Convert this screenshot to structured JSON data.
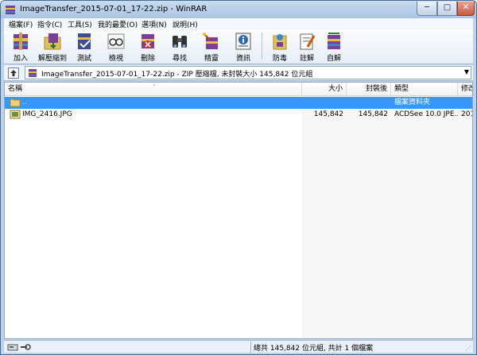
{
  "window": {
    "title": "ImageTransfer_2015-07-01_17-22.zip - WinRAR",
    "minimize": "─",
    "maximize": "□",
    "close": "✕"
  },
  "menu": [
    "檔案(F)",
    "指令(C)",
    "工具(S)",
    "我的最愛(O)",
    "選項(N)",
    "說明(H)"
  ],
  "toolbar": {
    "add": "加入",
    "extract_to": "解壓縮到",
    "test": "測試",
    "view": "檢視",
    "delete": "刪除",
    "find": "尋找",
    "wizard": "精靈",
    "info": "資訊",
    "protect": "防毒",
    "comment": "註解",
    "sfx": "自解"
  },
  "address": {
    "text": "ImageTransfer_2015-07-01_17-22.zip - ZIP 壓縮檔, 未封裝大小 145,842 位元組",
    "dropdown": "▼"
  },
  "columns": {
    "name": "名稱",
    "size": "大小",
    "packed": "封裝後",
    "type": "類型",
    "modified": "修改",
    "sort_indicator": "˄"
  },
  "rows": [
    {
      "name": "..",
      "size": "",
      "packed": "",
      "type": "檔案資料夾",
      "modified": ""
    },
    {
      "name": "IMG_2416.JPG",
      "size": "145,842",
      "packed": "145,842",
      "type": "ACDSee 10.0 JPE...",
      "modified": "201"
    }
  ],
  "status": {
    "text": "總共 145,842 位元組, 共計 1 個檔案",
    "grip": "⋰"
  },
  "colors": {
    "selection": "#3399ff",
    "titlebar": "#bcd3ec"
  }
}
